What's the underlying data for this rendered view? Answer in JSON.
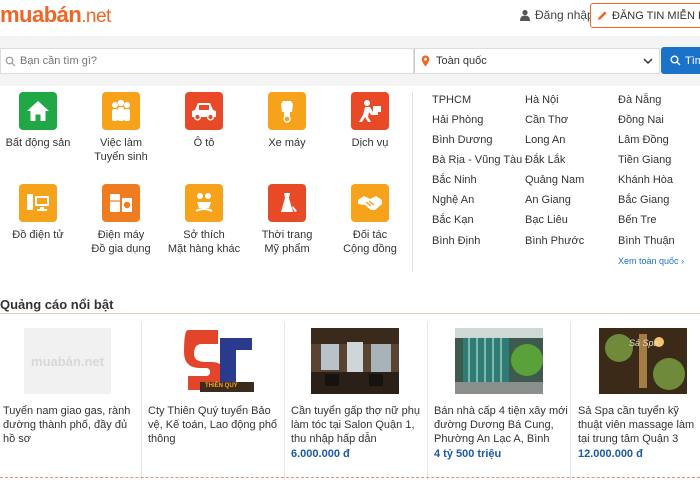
{
  "header": {
    "logo_main": "muabán",
    "logo_dot": ".",
    "logo_net": "net",
    "login_label": "Đăng nhập",
    "post_button_label": "ĐĂNG TIN MIỄN PHÍ"
  },
  "search": {
    "placeholder": "Bạn cần tìm gì?",
    "location_value": "Toàn quốc",
    "button_label": "Tìm"
  },
  "categories": [
    {
      "line1": "Bất động sản",
      "line2": "",
      "icon": "house-icon"
    },
    {
      "line1": "Việc làm",
      "line2": "Tuyển sinh",
      "icon": "people-icon"
    },
    {
      "line1": "Ô tô",
      "line2": "",
      "icon": "car-icon"
    },
    {
      "line1": "Xe máy",
      "line2": "",
      "icon": "scooter-icon"
    },
    {
      "line1": "Dịch vụ",
      "line2": "",
      "icon": "delivery-icon"
    },
    {
      "line1": "Đồ điện tử",
      "line2": "",
      "icon": "computer-icon"
    },
    {
      "line1": "Điện máy",
      "line2": "Đồ gia dụng",
      "icon": "appliance-icon"
    },
    {
      "line1": "Sở thích",
      "line2": "Mặt hàng khác",
      "icon": "hobby-icon"
    },
    {
      "line1": "Thời trang",
      "line2": "Mỹ phẩm",
      "icon": "fashion-icon"
    },
    {
      "line1": "Đối tác",
      "line2": "Cộng đồng",
      "icon": "handshake-icon"
    }
  ],
  "locations": [
    [
      "TPHCM",
      "Hà Nội",
      "Đà Nẵng"
    ],
    [
      "Hải Phòng",
      "Cần Thơ",
      "Đồng Nai"
    ],
    [
      "Bình Dương",
      "Long An",
      "Lâm Đồng"
    ],
    [
      "Bà Rịa - Vũng Tàu",
      "Đắk Lắk",
      "Tiền Giang"
    ],
    [
      "Bắc Ninh",
      "Quảng Nam",
      "Khánh Hòa"
    ],
    [
      "Nghệ An",
      "An Giang",
      "Bắc Giang"
    ],
    [
      "Bắc Kạn",
      "Bạc Liêu",
      "Bến Tre"
    ],
    [
      "Bình Định",
      "Bình Phước",
      "Bình Thuận"
    ]
  ],
  "see_all_label": "Xem toàn quốc",
  "featured": {
    "title": "Quảng cáo nổi bật",
    "ads": [
      {
        "title": "Tuyển nam giao gas, rành đường thành phố, đầy đủ hồ sơ",
        "price": "",
        "thumb_text": "muabán.net"
      },
      {
        "title": "Cty Thiên Quý tuyển Bảo vệ, Kế toán, Lao động phổ thông",
        "price": "",
        "thumb_text": "THIÊN QUÝ"
      },
      {
        "title": "Cần tuyển gấp thợ nữ phụ làm tóc tại Salon Quận 1, thu nhập hấp dẫn",
        "price": "6.000.000 đ",
        "thumb_text": ""
      },
      {
        "title": "Bán nhà cấp 4 tiện xây mới đường Dương Bá Cung, Phường An Lạc A, Bình",
        "price": "4 tỷ 500 triệu",
        "thumb_text": ""
      },
      {
        "title": "Sả Spa cần tuyển kỹ thuật viên massage làm tại trung tâm Quận 3",
        "price": "12.000.000 đ",
        "thumb_text": "Sả Spa"
      }
    ]
  },
  "colors": {
    "brand": "#f26522",
    "blue": "#1a73c9",
    "price": "#1a5aa6"
  }
}
